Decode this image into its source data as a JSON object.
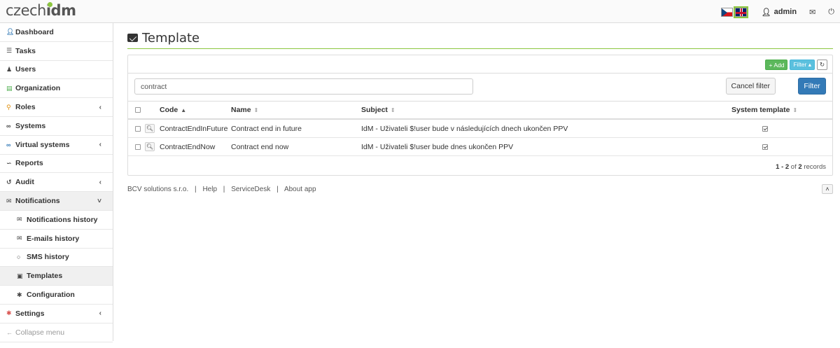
{
  "app": {
    "logo_main": "czech",
    "logo_bold": "idm"
  },
  "navbar": {
    "languages": [
      "cz",
      "en"
    ],
    "selected_language": "en",
    "user_label": "admin",
    "icons": [
      "user-icon",
      "envelope-icon",
      "power-icon"
    ]
  },
  "sidebar": {
    "items": [
      {
        "label": "Dashboard",
        "icon": "user-icon",
        "color": "#337ab7"
      },
      {
        "label": "Tasks",
        "icon": "list-icon"
      },
      {
        "label": "Users",
        "icon": "users-icon"
      },
      {
        "label": "Organization",
        "icon": "folder-icon",
        "color": "#4cae4c"
      },
      {
        "label": "Roles",
        "icon": "key-icon",
        "color": "#e08e0b",
        "has_submenu": true
      },
      {
        "label": "Systems",
        "icon": "link-icon"
      },
      {
        "label": "Virtual systems",
        "icon": "link-icon",
        "color": "#337ab7",
        "has_submenu": true
      },
      {
        "label": "Reports",
        "icon": "chart-icon"
      },
      {
        "label": "Audit",
        "icon": "history-icon",
        "has_submenu": true
      },
      {
        "label": "Notifications",
        "icon": "envelope-icon",
        "expanded": true
      },
      {
        "label": "Notifications history",
        "icon": "envelope-icon",
        "sub": true
      },
      {
        "label": "E-mails history",
        "icon": "envelope-open-icon",
        "sub": true
      },
      {
        "label": "SMS history",
        "icon": "comment-icon",
        "sub": true
      },
      {
        "label": "Templates",
        "icon": "template-icon",
        "sub": true,
        "active": true
      },
      {
        "label": "Configuration",
        "icon": "cog-icon",
        "sub": true
      },
      {
        "label": "Settings",
        "icon": "cog-icon",
        "color": "#d9534f",
        "has_submenu": true
      },
      {
        "label": "Collapse menu",
        "icon": "arrow-left-icon",
        "muted": true
      }
    ]
  },
  "main": {
    "title": "Template",
    "toolbar": {
      "add_label": "+ Add",
      "filter_label": "Filter ▴"
    },
    "filter": {
      "search_value": "contract",
      "cancel_label": "Cancel filter",
      "filter_label": "Filter"
    },
    "table": {
      "headers": {
        "code": "Code",
        "name": "Name",
        "subject": "Subject",
        "system": "System template"
      },
      "sorted_column": "Code",
      "rows": [
        {
          "code": "ContractEndInFuture",
          "name": "Contract end in future",
          "subject": "IdM - Uživateli $!user bude v následujících dnech ukončen PPV",
          "system_template": true
        },
        {
          "code": "ContractEndNow",
          "name": "Contract end now",
          "subject": "IdM - Uživateli $!user bude dnes ukončen PPV",
          "system_template": true
        }
      ]
    },
    "pager": {
      "range": "1 - 2",
      "of_text": "of",
      "total": "2",
      "records_text": "records"
    }
  },
  "footer": {
    "company": "BCV solutions s.r.o.",
    "links": [
      "Help",
      "ServiceDesk",
      "About app"
    ]
  }
}
